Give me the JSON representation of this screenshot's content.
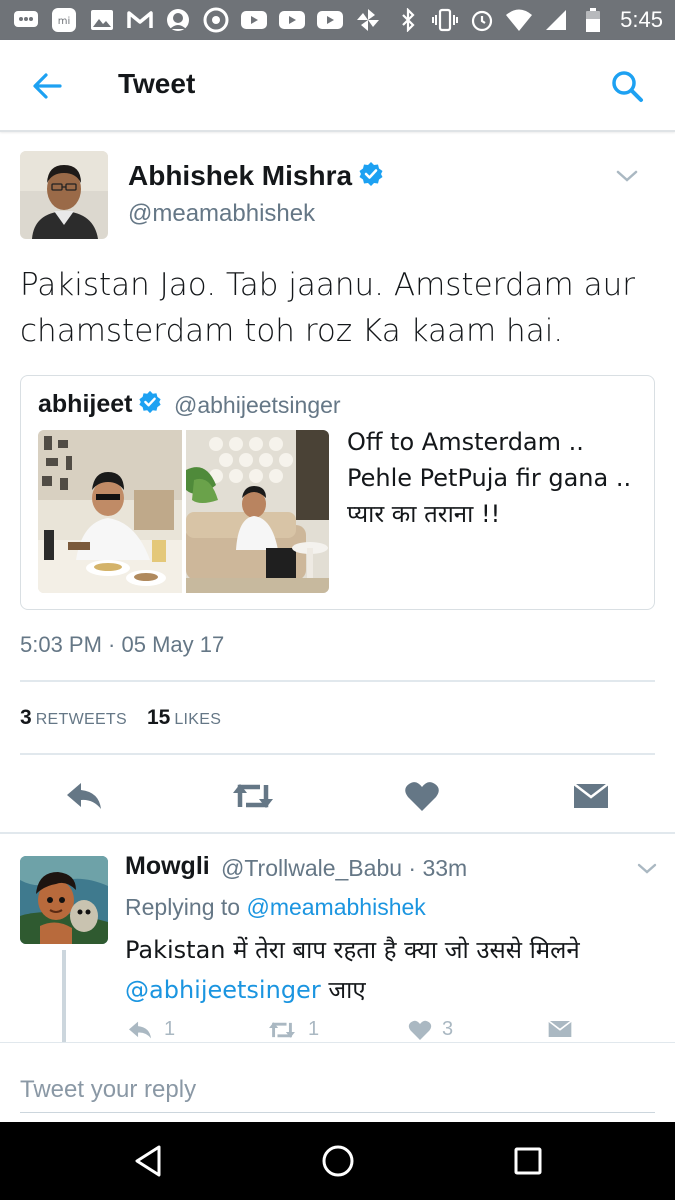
{
  "status_bar": {
    "time": "5:45",
    "left_icons": [
      "chat-icon",
      "mi-icon",
      "gallery-icon",
      "gmail-icon",
      "face-icon",
      "chrome-icon",
      "youtube-icon",
      "youtube-icon",
      "youtube-icon",
      "pinwheel-icon"
    ],
    "right_icons": [
      "bluetooth-icon",
      "vibrate-icon",
      "alarm-icon",
      "wifi-icon",
      "signal-icon",
      "battery-icon"
    ]
  },
  "app_bar": {
    "title": "Tweet"
  },
  "tweet": {
    "author_name": "Abhishek Mishra",
    "author_handle": "@meamabhishek",
    "text": "Pakistan Jao. Tab jaanu. Amsterdam aur chamsterdam toh roz Ka kaam hai.",
    "timestamp": "5:03 PM · 05 May 17",
    "retweets_count": "3",
    "retweets_label": "RETWEETS",
    "likes_count": "15",
    "likes_label": "LIKES"
  },
  "quoted": {
    "name": "abhijeet",
    "handle": "@abhijeetsinger",
    "lines": [
      "Off to Amsterdam ..",
      "Pehle PetPuja fir gana ..",
      " प्यार का तराना !!"
    ]
  },
  "reply": {
    "name": "Mowgli",
    "handle_time": "@Trollwale_Babu · 33m",
    "replying_prefix": "Replying to ",
    "replying_to": "@meamabhishek",
    "text_before": "Pakistan में तेरा बाप रहता है क्या जो उससे मिलने ",
    "mention": "@abhijeetsinger",
    "text_after": " जाए",
    "reply_count": "1",
    "retweet_count": "1",
    "like_count": "3"
  },
  "composer": {
    "placeholder": "Tweet your reply"
  },
  "colors": {
    "twitter_blue": "#1da1f2",
    "link_blue": "#1b95e0",
    "icon_gray": "#657786",
    "status_bar": "#6f7378"
  }
}
